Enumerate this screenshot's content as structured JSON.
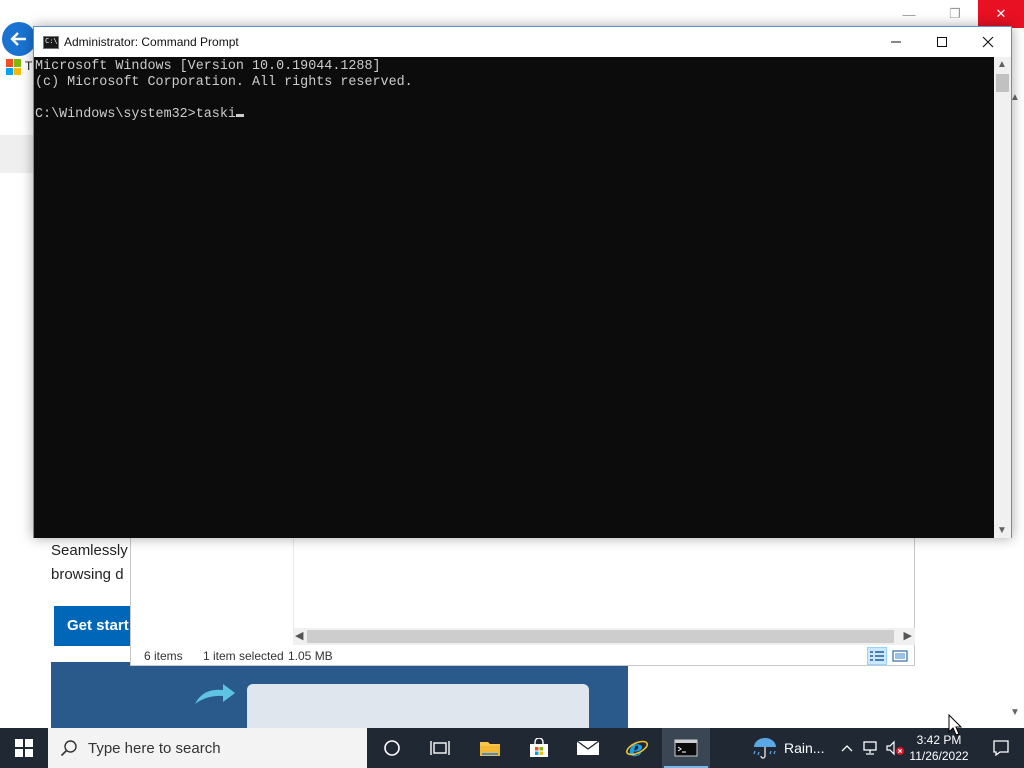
{
  "browser_bg": {
    "body_line1": "Seamlessly",
    "body_line2": "browsing d",
    "cta_label": "Get start",
    "partial_tab_letter": "T"
  },
  "explorer": {
    "item_count": "6 items",
    "selection": "1 item selected",
    "size": "1.05 MB"
  },
  "cmd": {
    "title": "Administrator: Command Prompt",
    "lines": [
      "Microsoft Windows [Version 10.0.19044.1288]",
      "(c) Microsoft Corporation. All rights reserved.",
      "",
      "C:\\Windows\\system32>taski"
    ]
  },
  "taskbar": {
    "search_placeholder": "Type here to search",
    "weather": "Rain...",
    "time": "3:42 PM",
    "date": "11/26/2022",
    "pinned": [
      "cortana-icon",
      "task-view-icon",
      "file-explorer-icon",
      "store-icon",
      "mail-icon",
      "internet-explorer-icon",
      "command-prompt-icon"
    ]
  },
  "colors": {
    "console_bg": "#0c0c0c",
    "console_text": "#cccccc",
    "taskbar_bg": "#1f2833",
    "accent": "#0067b8",
    "close_red": "#e81123"
  }
}
